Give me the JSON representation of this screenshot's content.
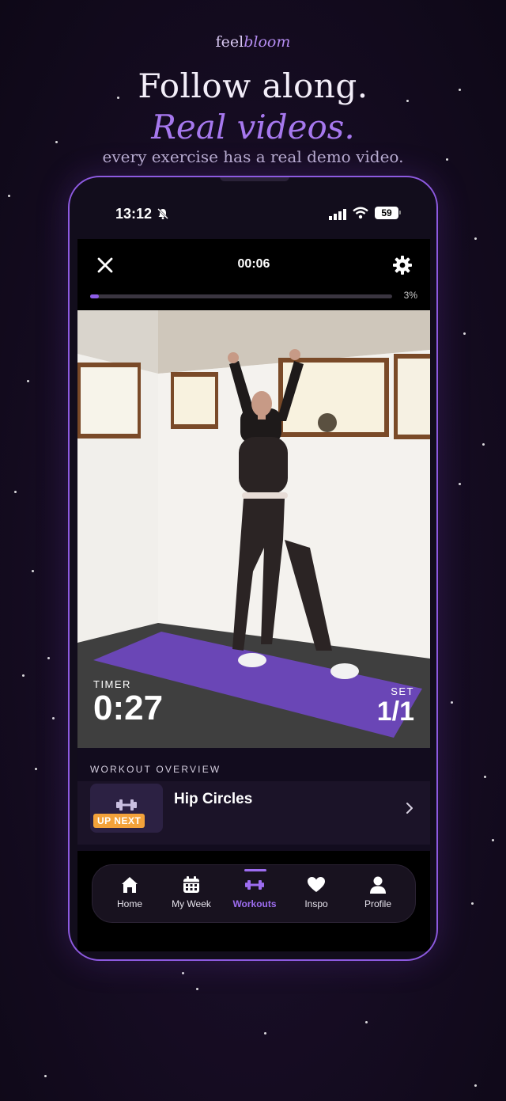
{
  "brand": {
    "part1": "feel",
    "part2": "bloom"
  },
  "headline": {
    "line1": "Follow along.",
    "line2": "Real videos.",
    "subtitle": "every exercise has a real demo video."
  },
  "status_bar": {
    "time": "13:12",
    "battery": "59",
    "icons": [
      "bell-slash-icon",
      "signal-icon",
      "wifi-icon",
      "battery-icon"
    ]
  },
  "player": {
    "elapsed": "00:06",
    "progress_label": "3%",
    "progress_percent": 3,
    "timer_label": "TIMER",
    "timer_value": "0:27",
    "set_label": "SET",
    "set_value": "1/1"
  },
  "overview": {
    "title": "WORKOUT OVERVIEW",
    "next_badge": "UP NEXT",
    "next_exercise": "Hip Circles"
  },
  "nav": {
    "items": [
      {
        "label": "Home",
        "icon": "home-icon"
      },
      {
        "label": "My Week",
        "icon": "calendar-icon"
      },
      {
        "label": "Workouts",
        "icon": "dumbbell-icon",
        "active": true
      },
      {
        "label": "Inspo",
        "icon": "heart-icon"
      },
      {
        "label": "Profile",
        "icon": "person-icon"
      }
    ]
  },
  "colors": {
    "accent": "#9d6df0",
    "badge": "#f3a23a",
    "background": "#170d24"
  }
}
